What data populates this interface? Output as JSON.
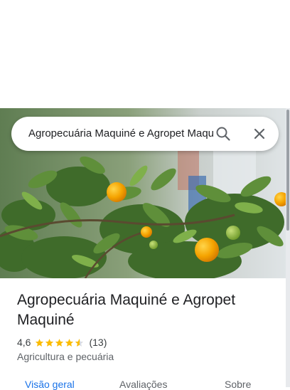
{
  "search": {
    "value": "Agropecuária Maquiné e Agropet Maquiné",
    "search_icon": "search-icon",
    "close_icon": "close-icon"
  },
  "place": {
    "title": "Agropecuária Maquiné e Agropet Maquiné",
    "rating": "4,6",
    "rating_stars": 4.6,
    "review_count": "(13)",
    "category": "Agricultura e pecuária"
  },
  "tabs": [
    {
      "label": "Visão geral",
      "active": true
    },
    {
      "label": "Avaliações",
      "active": false
    },
    {
      "label": "Sobre",
      "active": false
    }
  ],
  "colors": {
    "star": "#fbbc04",
    "active_tab": "#1a73e8",
    "text_primary": "#202124",
    "text_secondary": "#5f6368"
  }
}
